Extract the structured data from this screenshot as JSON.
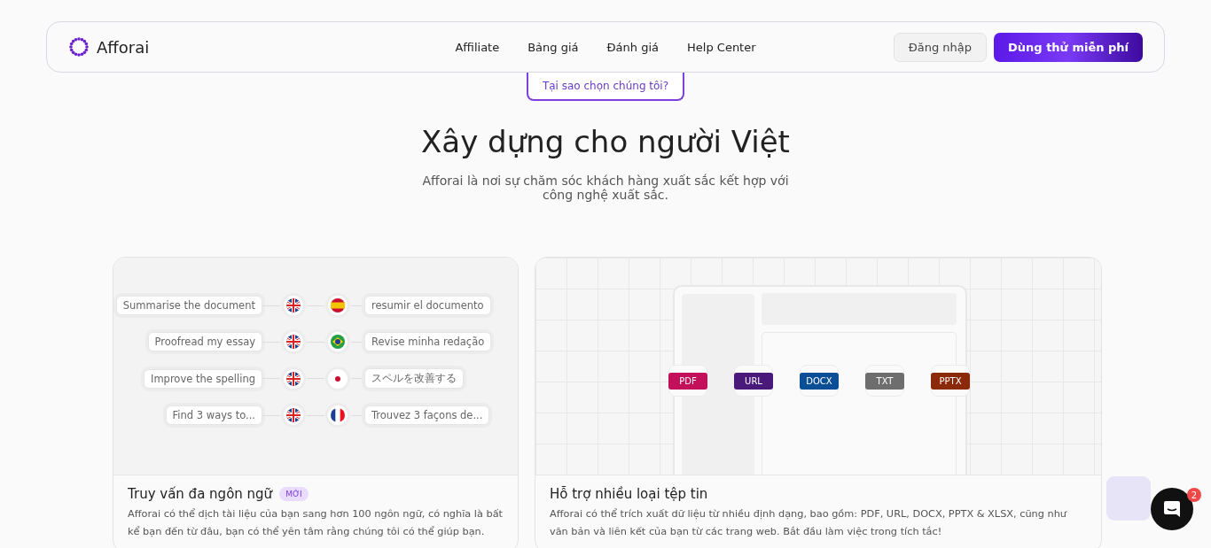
{
  "nav": {
    "brand": "Afforai",
    "links": [
      "Affiliate",
      "Bảng giá",
      "Đánh giá",
      "Help Center"
    ],
    "login": "Đăng nhập",
    "cta": "Dùng thử miễn phí"
  },
  "hero": {
    "badge": "Tại sao chọn chúng tôi?",
    "title": "Xây dựng cho người Việt",
    "subtitle": "Afforai là nơi sự chăm sóc khách hàng xuất sắc kết hợp với công nghệ xuất sắc."
  },
  "translation_card": {
    "rows": [
      {
        "source": "Summarise the document",
        "target": "resumir el documento",
        "kind": "es"
      },
      {
        "source": "Proofread my essay",
        "target": "Revise minha redação",
        "kind": "br"
      },
      {
        "source": "Improve the spelling",
        "target": "スペルを改善する",
        "kind": "jp"
      },
      {
        "source": "Find 3 ways to...",
        "target": "Trouvez 3 façons de...",
        "kind": "fr"
      }
    ],
    "title": "Truy vấn đa ngôn ngữ",
    "tag": "MỚI",
    "text": "Afforai có thể dịch tài liệu của bạn sang hơn 100 ngôn ngữ, có nghĩa là bất kể bạn đến từ đâu, bạn có thể yên tâm rằng chúng tôi có thể giúp bạn."
  },
  "file_card": {
    "formats": [
      {
        "label": "PDF",
        "color": "#c2105a"
      },
      {
        "label": "URL",
        "color": "#4a1a7a"
      },
      {
        "label": "DOCX",
        "color": "#0a4f95"
      },
      {
        "label": "TXT",
        "color": "#6e6e6e"
      },
      {
        "label": "PPTX",
        "color": "#8a2a0a"
      }
    ],
    "title": "Hỗ trợ nhiều loại tệp tin",
    "text": "Afforai có thể trích xuất dữ liệu từ nhiều định dạng, bao gồm: PDF, URL, DOCX, PPTX & XLSX, cũng như văn bản và liên kết của bạn từ các trang web. Bắt đầu làm việc trong tích tắc!"
  },
  "chat": {
    "unread": "2"
  }
}
